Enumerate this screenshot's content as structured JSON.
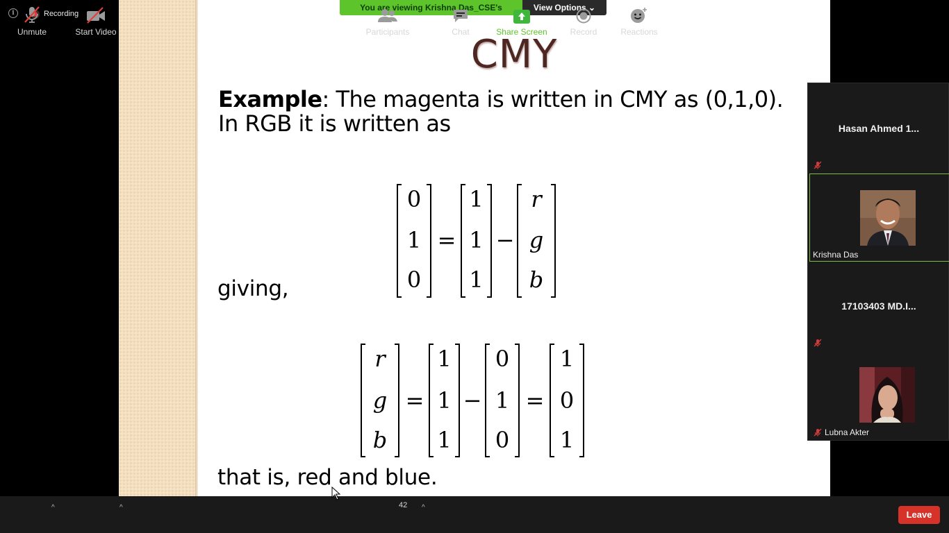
{
  "recording": {
    "label": "Recording"
  },
  "banner": {
    "viewing": "You are viewing Krishna Das_CSE's screen",
    "view_options": "View Options ⌄"
  },
  "slide": {
    "title": "CMY",
    "example_label": "Example",
    "example_text": ": The magenta is written in CMY as (0,1,0). In RGB it is written as",
    "giving": "giving,",
    "conclusion": "that is, red and blue.",
    "eq1": {
      "lhs": [
        "0",
        "1",
        "0"
      ],
      "m1": [
        "1",
        "1",
        "1"
      ],
      "m2": [
        "r",
        "g",
        "b"
      ]
    },
    "eq2": {
      "lhs": [
        "r",
        "g",
        "b"
      ],
      "m1": [
        "1",
        "1",
        "1"
      ],
      "m2": [
        "0",
        "1",
        "0"
      ],
      "res": [
        "1",
        "0",
        "1"
      ]
    }
  },
  "participants_panel": {
    "tiles": [
      {
        "name": "Hasan Ahmed 1...",
        "muted": true,
        "has_video": false
      },
      {
        "name": "Krishna Das",
        "muted": false,
        "has_video": true,
        "active": true
      },
      {
        "name": "17103403 MD.I...",
        "muted": true,
        "has_video": false
      },
      {
        "name": "Lubna Akter",
        "muted": true,
        "has_video": true
      }
    ]
  },
  "toolbar": {
    "unmute": "Unmute",
    "start_video": "Start Video",
    "participants": "Participants",
    "participants_count": "42",
    "chat": "Chat",
    "share_screen": "Share Screen",
    "record": "Record",
    "reactions": "Reactions",
    "leave": "Leave"
  },
  "colors": {
    "share_green": "#5ec42b",
    "leave_red": "#d6322a",
    "title_brown": "#4e2722",
    "active_border": "#7fbf3f"
  }
}
